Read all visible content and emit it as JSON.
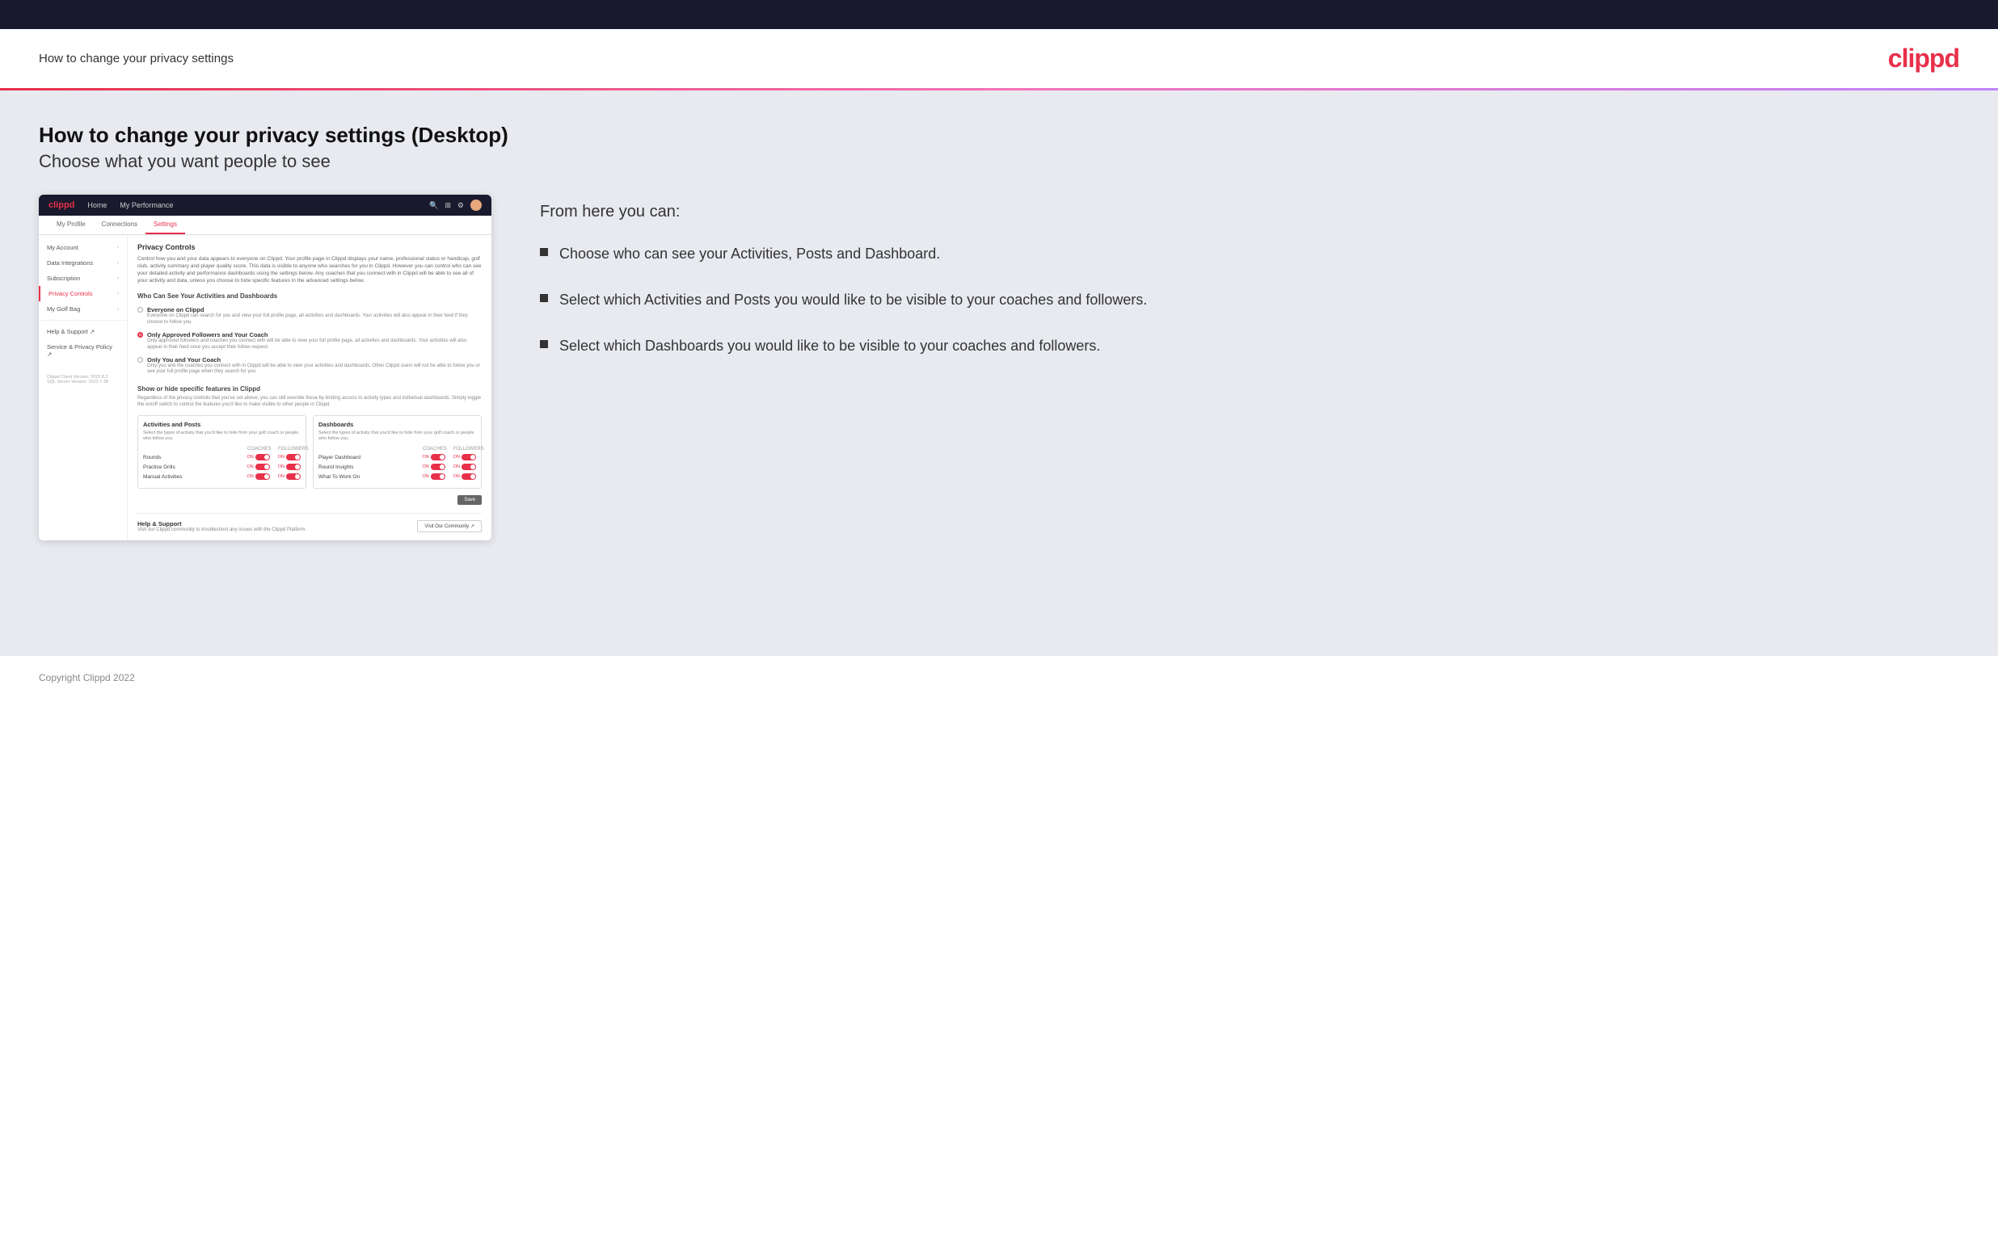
{
  "topBar": {},
  "header": {
    "title": "How to change your privacy settings",
    "logo": "clippd"
  },
  "main": {
    "heading": "How to change your privacy settings (Desktop)",
    "subheading": "Choose what you want people to see",
    "screenshot": {
      "navbar": {
        "logo": "clippd",
        "links": [
          "Home",
          "My Performance"
        ]
      },
      "tabs": [
        "My Profile",
        "Connections",
        "Settings"
      ],
      "activeTab": "Settings",
      "sidebar": {
        "items": [
          {
            "label": "My Account",
            "hasChevron": true
          },
          {
            "label": "Data Integrations",
            "hasChevron": true
          },
          {
            "label": "Subscription",
            "hasChevron": true
          },
          {
            "label": "Privacy Controls",
            "hasChevron": true,
            "active": true
          },
          {
            "label": "My Golf Bag",
            "hasChevron": true
          },
          {
            "label": "Help & Support",
            "hasChevron": false,
            "icon": "external"
          },
          {
            "label": "Service & Privacy Policy",
            "hasChevron": false,
            "icon": "external"
          }
        ],
        "version": "Clippd Client Version: 2022.8.2\nSQL Server Version: 2022.7.38"
      },
      "content": {
        "sectionTitle": "Privacy Controls",
        "sectionDesc": "Control how you and your data appears to everyone on Clippd. Your profile page in Clippd displays your name, professional status or handicap, golf club, activity summary and player quality score. This data is visible to anyone who searches for you in Clippd. However you can control who can see your detailed activity and performance dashboards using the settings below. Any coaches that you connect with in Clippd will be able to see all of your activity and data, unless you choose to hide specific features in the advanced settings below.",
        "whoCanTitle": "Who Can See Your Activities and Dashboards",
        "radioOptions": [
          {
            "label": "Everyone on Clippd",
            "desc": "Everyone on Clippd can search for you and view your full profile page, all activities and dashboards. Your activities will also appear in their feed if they choose to follow you.",
            "selected": false
          },
          {
            "label": "Only Approved Followers and Your Coach",
            "desc": "Only approved followers and coaches you connect with will be able to view your full profile page, all activities and dashboards. Your activities will also appear in their feed once you accept their follow request.",
            "selected": true
          },
          {
            "label": "Only You and Your Coach",
            "desc": "Only you and the coaches you connect with in Clippd will be able to view your activities and dashboards. Other Clippd users will not be able to follow you or see your full profile page when they search for you.",
            "selected": false
          }
        ],
        "showHideTitle": "Show or hide specific features in Clippd",
        "showHideDesc": "Regardless of the privacy controls that you've set above, you can still override these by limiting access to activity types and individual dashboards. Simply toggle the on/off switch to control the features you'd like to make visible to other people in Clippd.",
        "activitiesBox": {
          "title": "Activities and Posts",
          "desc": "Select the types of activity that you'd like to hide from your golf coach or people who follow you.",
          "columns": [
            "COACHES",
            "FOLLOWERS"
          ],
          "rows": [
            {
              "name": "Rounds",
              "coachesOn": true,
              "followersOn": true
            },
            {
              "name": "Practice Drills",
              "coachesOn": true,
              "followersOn": true
            },
            {
              "name": "Manual Activities",
              "coachesOn": true,
              "followersOn": true
            }
          ]
        },
        "dashboardsBox": {
          "title": "Dashboards",
          "desc": "Select the types of activity that you'd like to hide from your golf coach or people who follow you.",
          "columns": [
            "COACHES",
            "FOLLOWERS"
          ],
          "rows": [
            {
              "name": "Player Dashboard",
              "coachesOn": true,
              "followersOn": true
            },
            {
              "name": "Round Insights",
              "coachesOn": true,
              "followersOn": true
            },
            {
              "name": "What To Work On",
              "coachesOn": true,
              "followersOn": true
            }
          ]
        },
        "saveLabel": "Save",
        "help": {
          "title": "Help & Support",
          "desc": "Visit our Clippd community to troubleshoot any issues with the Clippd Platform.",
          "buttonLabel": "Visit Our Community"
        }
      }
    },
    "rightPanel": {
      "fromHereTitle": "From here you can:",
      "bullets": [
        "Choose who can see your Activities, Posts and Dashboard.",
        "Select which Activities and Posts you would like to be visible to your coaches and followers.",
        "Select which Dashboards you would like to be visible to your coaches and followers."
      ]
    }
  },
  "footer": {
    "copyright": "Copyright Clippd 2022"
  }
}
